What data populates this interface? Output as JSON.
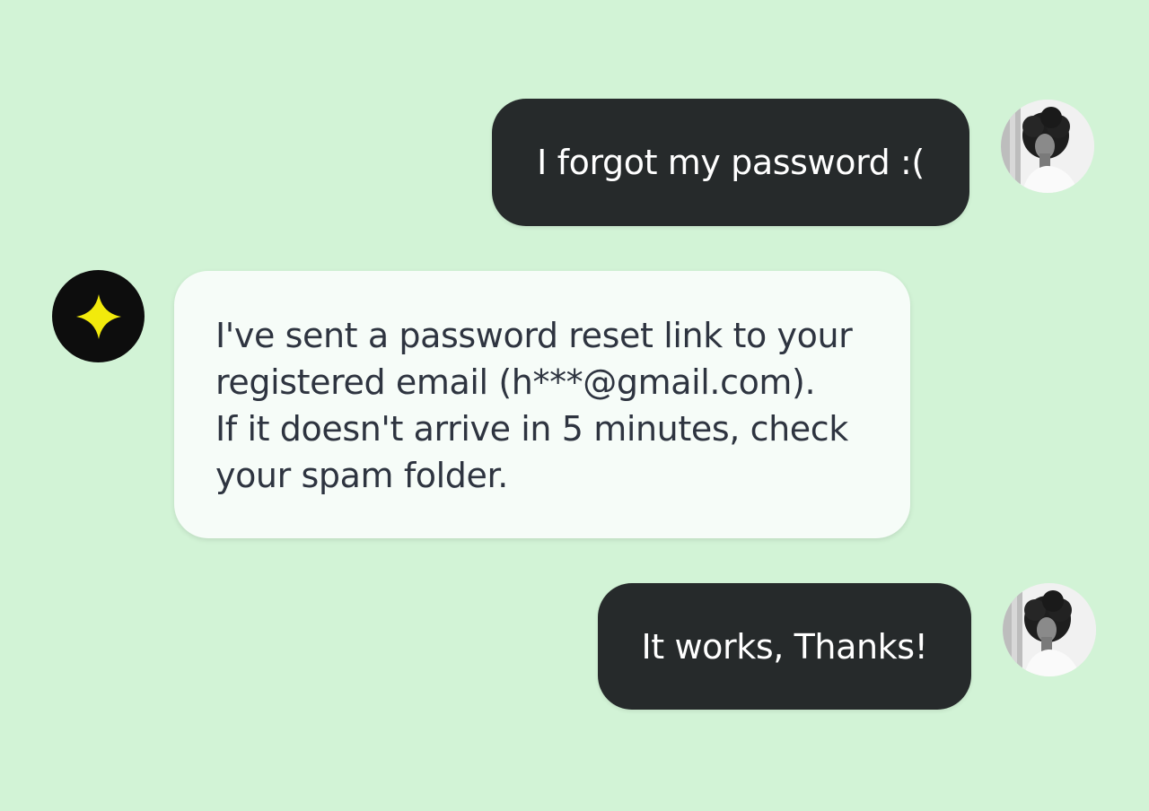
{
  "conversation": {
    "messages": [
      {
        "sender": "user",
        "text": "I forgot my password :("
      },
      {
        "sender": "bot",
        "lines": [
          "I've sent a password reset link to your",
          "registered email (h***@gmail.com).",
          "If it doesn't arrive in 5 minutes, check",
          "your spam folder."
        ]
      },
      {
        "sender": "user",
        "text": "It works, Thanks!"
      }
    ]
  },
  "icons": {
    "user_avatar": "user-photo-avatar",
    "bot_avatar": "sparkle-icon"
  },
  "colors": {
    "background": "#d2f3d6",
    "user_bubble": "#262a2b",
    "user_text": "#ffffff",
    "bot_bubble": "#f6fcf8",
    "bot_text": "#2e3440",
    "bot_avatar_bg": "#0d0d0d",
    "sparkle": "#f2ea0c"
  }
}
